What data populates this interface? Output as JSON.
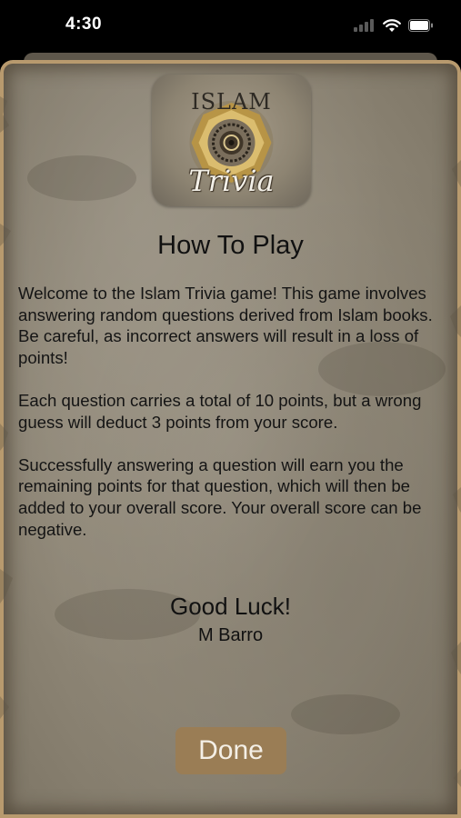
{
  "status_bar": {
    "time": "4:30",
    "icons": [
      "cellular-signal-icon",
      "wifi-icon",
      "battery-icon"
    ]
  },
  "app_icon": {
    "top_text": "ISLAM",
    "bottom_text": "Trivia"
  },
  "content": {
    "title": "How To Play",
    "paragraphs": [
      "Welcome to the Islam Trivia game! This game involves answering random questions derived from Islam books. Be careful, as incorrect answers will result in a loss of points!",
      "Each question carries a total of 10 points, but a wrong guess will deduct 3 points from your score.",
      "Successfully answering a question will earn you the remaining points for that question, which will then be added to your overall score. Your overall score can be negative."
    ],
    "closing": "Good Luck!",
    "author": "M Barro"
  },
  "actions": {
    "done_label": "Done"
  },
  "colors": {
    "parchment": "#8f8777",
    "border": "#b89a6e",
    "button": "#9a7d55",
    "text": "#141414"
  }
}
